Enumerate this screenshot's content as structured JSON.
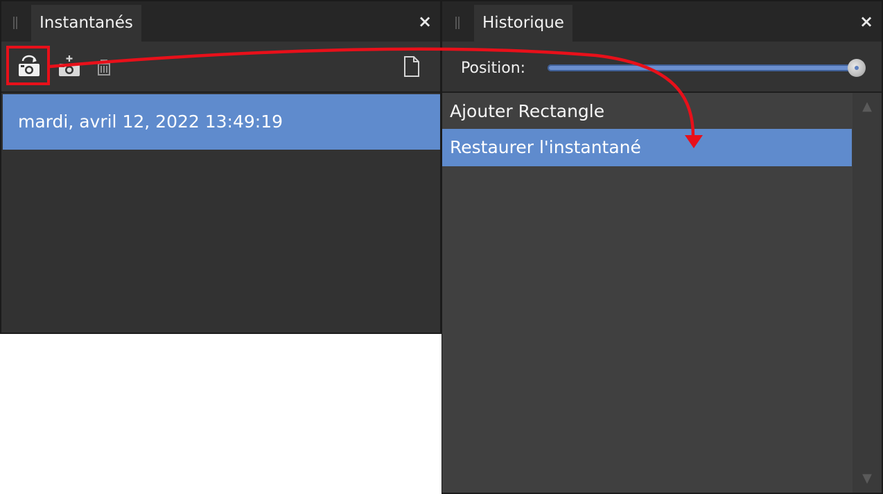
{
  "snapshots_panel": {
    "tab_label": "Instantanés",
    "close_label": "×",
    "items": [
      {
        "label": "mardi, avril 12, 2022 13:49:19",
        "selected": true
      }
    ]
  },
  "history_panel": {
    "tab_label": "Historique",
    "close_label": "×",
    "position_label": "Position:",
    "position_value": 1.0,
    "items": [
      {
        "label": "Ajouter Rectangle",
        "selected": false
      },
      {
        "label": "Restaurer l'instantané",
        "selected": true
      }
    ],
    "scroll_up": "▲",
    "scroll_down": "▼"
  },
  "icons": {
    "restore_snapshot": "camera-restore-icon",
    "add_snapshot": "camera-add-icon",
    "delete": "trash-icon",
    "document": "document-icon"
  },
  "colors": {
    "selection": "#5f8bcd",
    "annotation": "#e8101a",
    "panel_bg": "#2f2f2f"
  }
}
